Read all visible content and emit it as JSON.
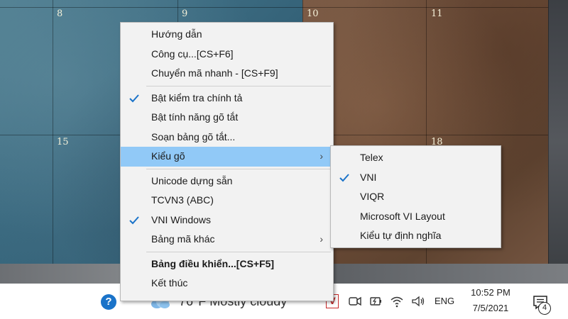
{
  "calendar": {
    "days": [
      "8",
      "9",
      "10",
      "11",
      "15",
      "18"
    ]
  },
  "menu": {
    "items": [
      {
        "label": "Hướng dẫn"
      },
      {
        "label": "Công cụ...[CS+F6]"
      },
      {
        "label": "Chuyển mã nhanh - [CS+F9]"
      },
      {
        "label": "Bật kiểm tra chính tả",
        "checked": true
      },
      {
        "label": "Bật tính năng gõ tắt"
      },
      {
        "label": "Soạn bảng gõ tắt..."
      },
      {
        "label": "Kiểu gõ",
        "submenu": true,
        "highlighted": true
      },
      {
        "label": "Unicode dựng sẵn"
      },
      {
        "label": "TCVN3 (ABC)"
      },
      {
        "label": "VNI Windows",
        "checked": true
      },
      {
        "label": "Bảng mã khác",
        "submenu": true
      },
      {
        "label": "Bảng điều khiển...[CS+F5]",
        "bold": true
      },
      {
        "label": "Kết thúc"
      }
    ]
  },
  "submenu": {
    "items": [
      {
        "label": "Telex"
      },
      {
        "label": "VNI",
        "checked": true
      },
      {
        "label": "VIQR"
      },
      {
        "label": "Microsoft VI Layout"
      },
      {
        "label": "Kiểu tự định nghĩa"
      }
    ]
  },
  "taskbar": {
    "help_icon": "question-icon",
    "help_glyph": "?",
    "weather_text": "76°F  Mostly cloudy",
    "chevron": "^",
    "vn_indicator": "V",
    "language": "ENG",
    "time": "10:52 PM",
    "date": "7/5/2021",
    "notification_count": "4"
  },
  "colors": {
    "menu_bg": "#f2f2f2",
    "highlight": "#91c9f7",
    "check": "#1a73c9",
    "vn_red": "#c62828"
  }
}
